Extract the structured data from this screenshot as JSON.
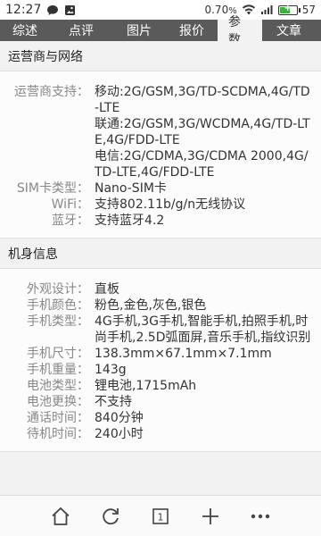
{
  "status_bar": {
    "time": "12:27",
    "data_rate": "0.70",
    "data_rate_unit": "%",
    "battery": "57",
    "battery_level": 0.57,
    "icons": [
      "chat-bubble-icon",
      "image-icon",
      "wifi-icon",
      "signal-icon",
      "battery-icon"
    ]
  },
  "tabs": [
    {
      "label": "综述",
      "active": false
    },
    {
      "label": "点评",
      "active": false
    },
    {
      "label": "图片",
      "active": false
    },
    {
      "label": "报价",
      "active": false
    },
    {
      "label": "参数",
      "active": true
    },
    {
      "label": "文章",
      "active": false
    }
  ],
  "sections": [
    {
      "title": "运营商与网络",
      "rows": [
        {
          "label": "运营商支持：",
          "lines": [
            "移动:2G/GSM,3G/TD-SCDMA,4G/TD-LTE",
            "联通:2G/GSM,3G/WCDMA,4G/TD-LTE,4G/FDD-LTE",
            "电信:2G/CDMA,3G/CDMA 2000,4G/TD-LTE,4G/FDD-LTE"
          ]
        },
        {
          "label": "SIM卡类型：",
          "lines": [
            "Nano-SIM卡"
          ]
        },
        {
          "label": "WiFi：",
          "lines": [
            "支持802.11b/g/n无线协议"
          ]
        },
        {
          "label": "蓝牙：",
          "lines": [
            "支持蓝牙4.2"
          ]
        }
      ]
    },
    {
      "title": "机身信息",
      "rows": [
        {
          "label": "外观设计：",
          "lines": [
            "直板"
          ]
        },
        {
          "label": "手机颜色：",
          "lines": [
            "粉色,金色,灰色,银色"
          ]
        },
        {
          "label": "手机类型：",
          "lines": [
            "4G手机,3G手机,智能手机,拍照手机,时尚手机,2.5D弧面屏,音乐手机,指纹识别"
          ]
        },
        {
          "label": "手机尺寸：",
          "lines": [
            "138.3mm×67.1mm×7.1mm"
          ]
        },
        {
          "label": "手机重量：",
          "lines": [
            "143g"
          ]
        },
        {
          "label": "电池类型：",
          "lines": [
            "锂电池,1715mAh"
          ]
        },
        {
          "label": "电池更换：",
          "lines": [
            "不支持"
          ]
        },
        {
          "label": "通话时间：",
          "lines": [
            "840分钟"
          ]
        },
        {
          "label": "待机时间：",
          "lines": [
            "240小时"
          ]
        }
      ]
    }
  ],
  "bottom_nav": [
    {
      "name": "home-icon"
    },
    {
      "name": "refresh-icon"
    },
    {
      "name": "tabs-icon",
      "count": "1"
    },
    {
      "name": "plus-icon"
    },
    {
      "name": "more-icon"
    }
  ]
}
